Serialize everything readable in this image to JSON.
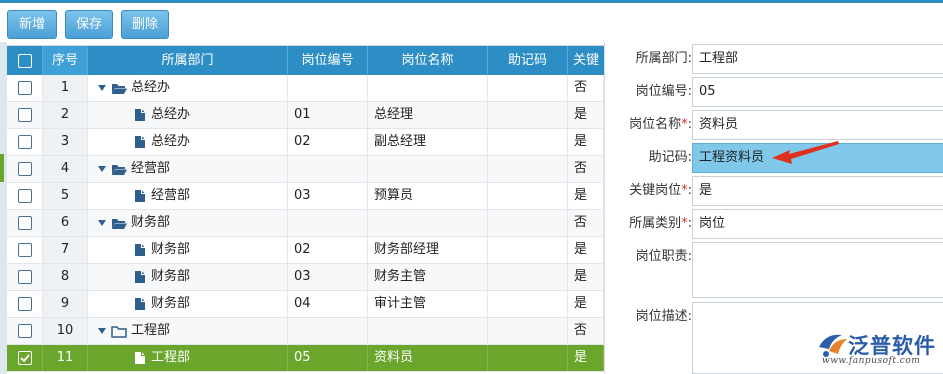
{
  "toolbar": {
    "new_label": "新增",
    "save_label": "保存",
    "delete_label": "删除"
  },
  "grid": {
    "headers": {
      "seq": "序号",
      "dept": "所属部门",
      "code": "岗位编号",
      "name": "岗位名称",
      "memo": "助记码",
      "key": "关键"
    },
    "rows": [
      {
        "seq": "1",
        "dept": "总经办",
        "code": "",
        "name": "",
        "memo": "",
        "key": "否",
        "type": "folder"
      },
      {
        "seq": "2",
        "dept": "总经办",
        "code": "01",
        "name": "总经理",
        "memo": "",
        "key": "是",
        "type": "doc"
      },
      {
        "seq": "3",
        "dept": "总经办",
        "code": "02",
        "name": "副总经理",
        "memo": "",
        "key": "是",
        "type": "doc"
      },
      {
        "seq": "4",
        "dept": "经营部",
        "code": "",
        "name": "",
        "memo": "",
        "key": "否",
        "type": "folder"
      },
      {
        "seq": "5",
        "dept": "经营部",
        "code": "03",
        "name": "预算员",
        "memo": "",
        "key": "是",
        "type": "doc"
      },
      {
        "seq": "6",
        "dept": "财务部",
        "code": "",
        "name": "",
        "memo": "",
        "key": "否",
        "type": "folder"
      },
      {
        "seq": "7",
        "dept": "财务部",
        "code": "02",
        "name": "财务部经理",
        "memo": "",
        "key": "是",
        "type": "doc"
      },
      {
        "seq": "8",
        "dept": "财务部",
        "code": "03",
        "name": "财务主管",
        "memo": "",
        "key": "是",
        "type": "doc"
      },
      {
        "seq": "9",
        "dept": "财务部",
        "code": "04",
        "name": "审计主管",
        "memo": "",
        "key": "是",
        "type": "doc"
      },
      {
        "seq": "10",
        "dept": "工程部",
        "code": "",
        "name": "",
        "memo": "",
        "key": "否",
        "type": "folder-empty"
      },
      {
        "seq": "11",
        "dept": "工程部",
        "code": "05",
        "name": "资料员",
        "memo": "",
        "key": "是",
        "type": "doc-selected",
        "selected": true
      }
    ]
  },
  "form": {
    "dept": {
      "label": "所属部门:",
      "value": "工程部"
    },
    "code": {
      "label": "岗位编号:",
      "value": "05"
    },
    "name": {
      "label": "岗位名称",
      "required": "*",
      "colon": ":",
      "value": "资料员"
    },
    "memo": {
      "label": "助记码:",
      "value": "工程资料员"
    },
    "key": {
      "label": "关键岗位",
      "required": "*",
      "colon": ":",
      "value": "是"
    },
    "category": {
      "label": "所属类别",
      "required": "*",
      "colon": ":",
      "value": "岗位"
    },
    "duty": {
      "label": "岗位职责:",
      "value": ""
    },
    "desc": {
      "label": "岗位描述:",
      "value": ""
    }
  },
  "logo": {
    "name": "泛普软件",
    "url": "www.fanpusoft.com"
  },
  "colors": {
    "header_blue": "#2d8ec6",
    "selected_green": "#6aa62c",
    "highlight_blue": "#7fc8ea",
    "arrow_red": "#e0301e"
  },
  "icons": {
    "folder": "folder-open-icon",
    "doc": "document-icon",
    "check": "checkmark-icon"
  }
}
